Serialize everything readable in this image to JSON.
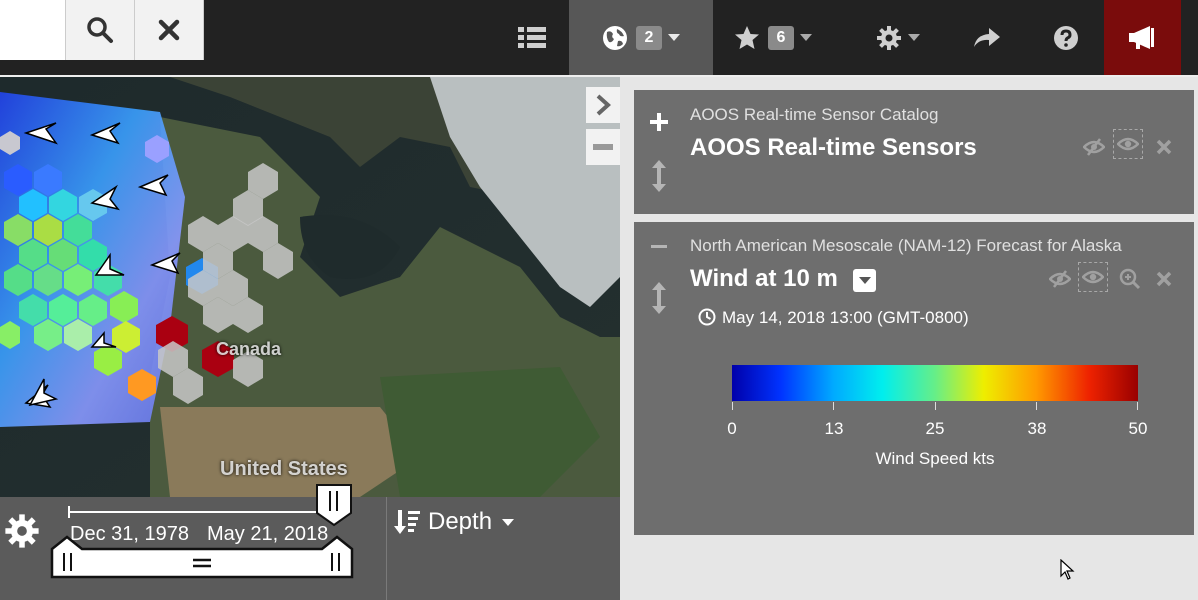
{
  "toolbar": {
    "layers_count": "2",
    "favorites_count": "6",
    "colors": {
      "bar": "#222222",
      "active": "#575757",
      "alert": "#7a0c0c"
    }
  },
  "map": {
    "labels": {
      "canada": "Canada",
      "united_states": "United States"
    }
  },
  "timebar": {
    "start_date": "Dec 31, 1978",
    "end_date": "May 21, 2018",
    "depth_label": "Depth"
  },
  "layers": [
    {
      "subtitle": "AOOS Real-time Sensor Catalog",
      "title": "AOOS Real-time Sensors"
    },
    {
      "subtitle": "North American Mesoscale (NAM-12) Forecast for Alaska",
      "title": "Wind at 10 m",
      "time": "May 14, 2018 13:00 (GMT-0800)",
      "legend": {
        "ticks": [
          "0",
          "13",
          "25",
          "38",
          "50"
        ],
        "title": "Wind Speed kts"
      }
    }
  ]
}
